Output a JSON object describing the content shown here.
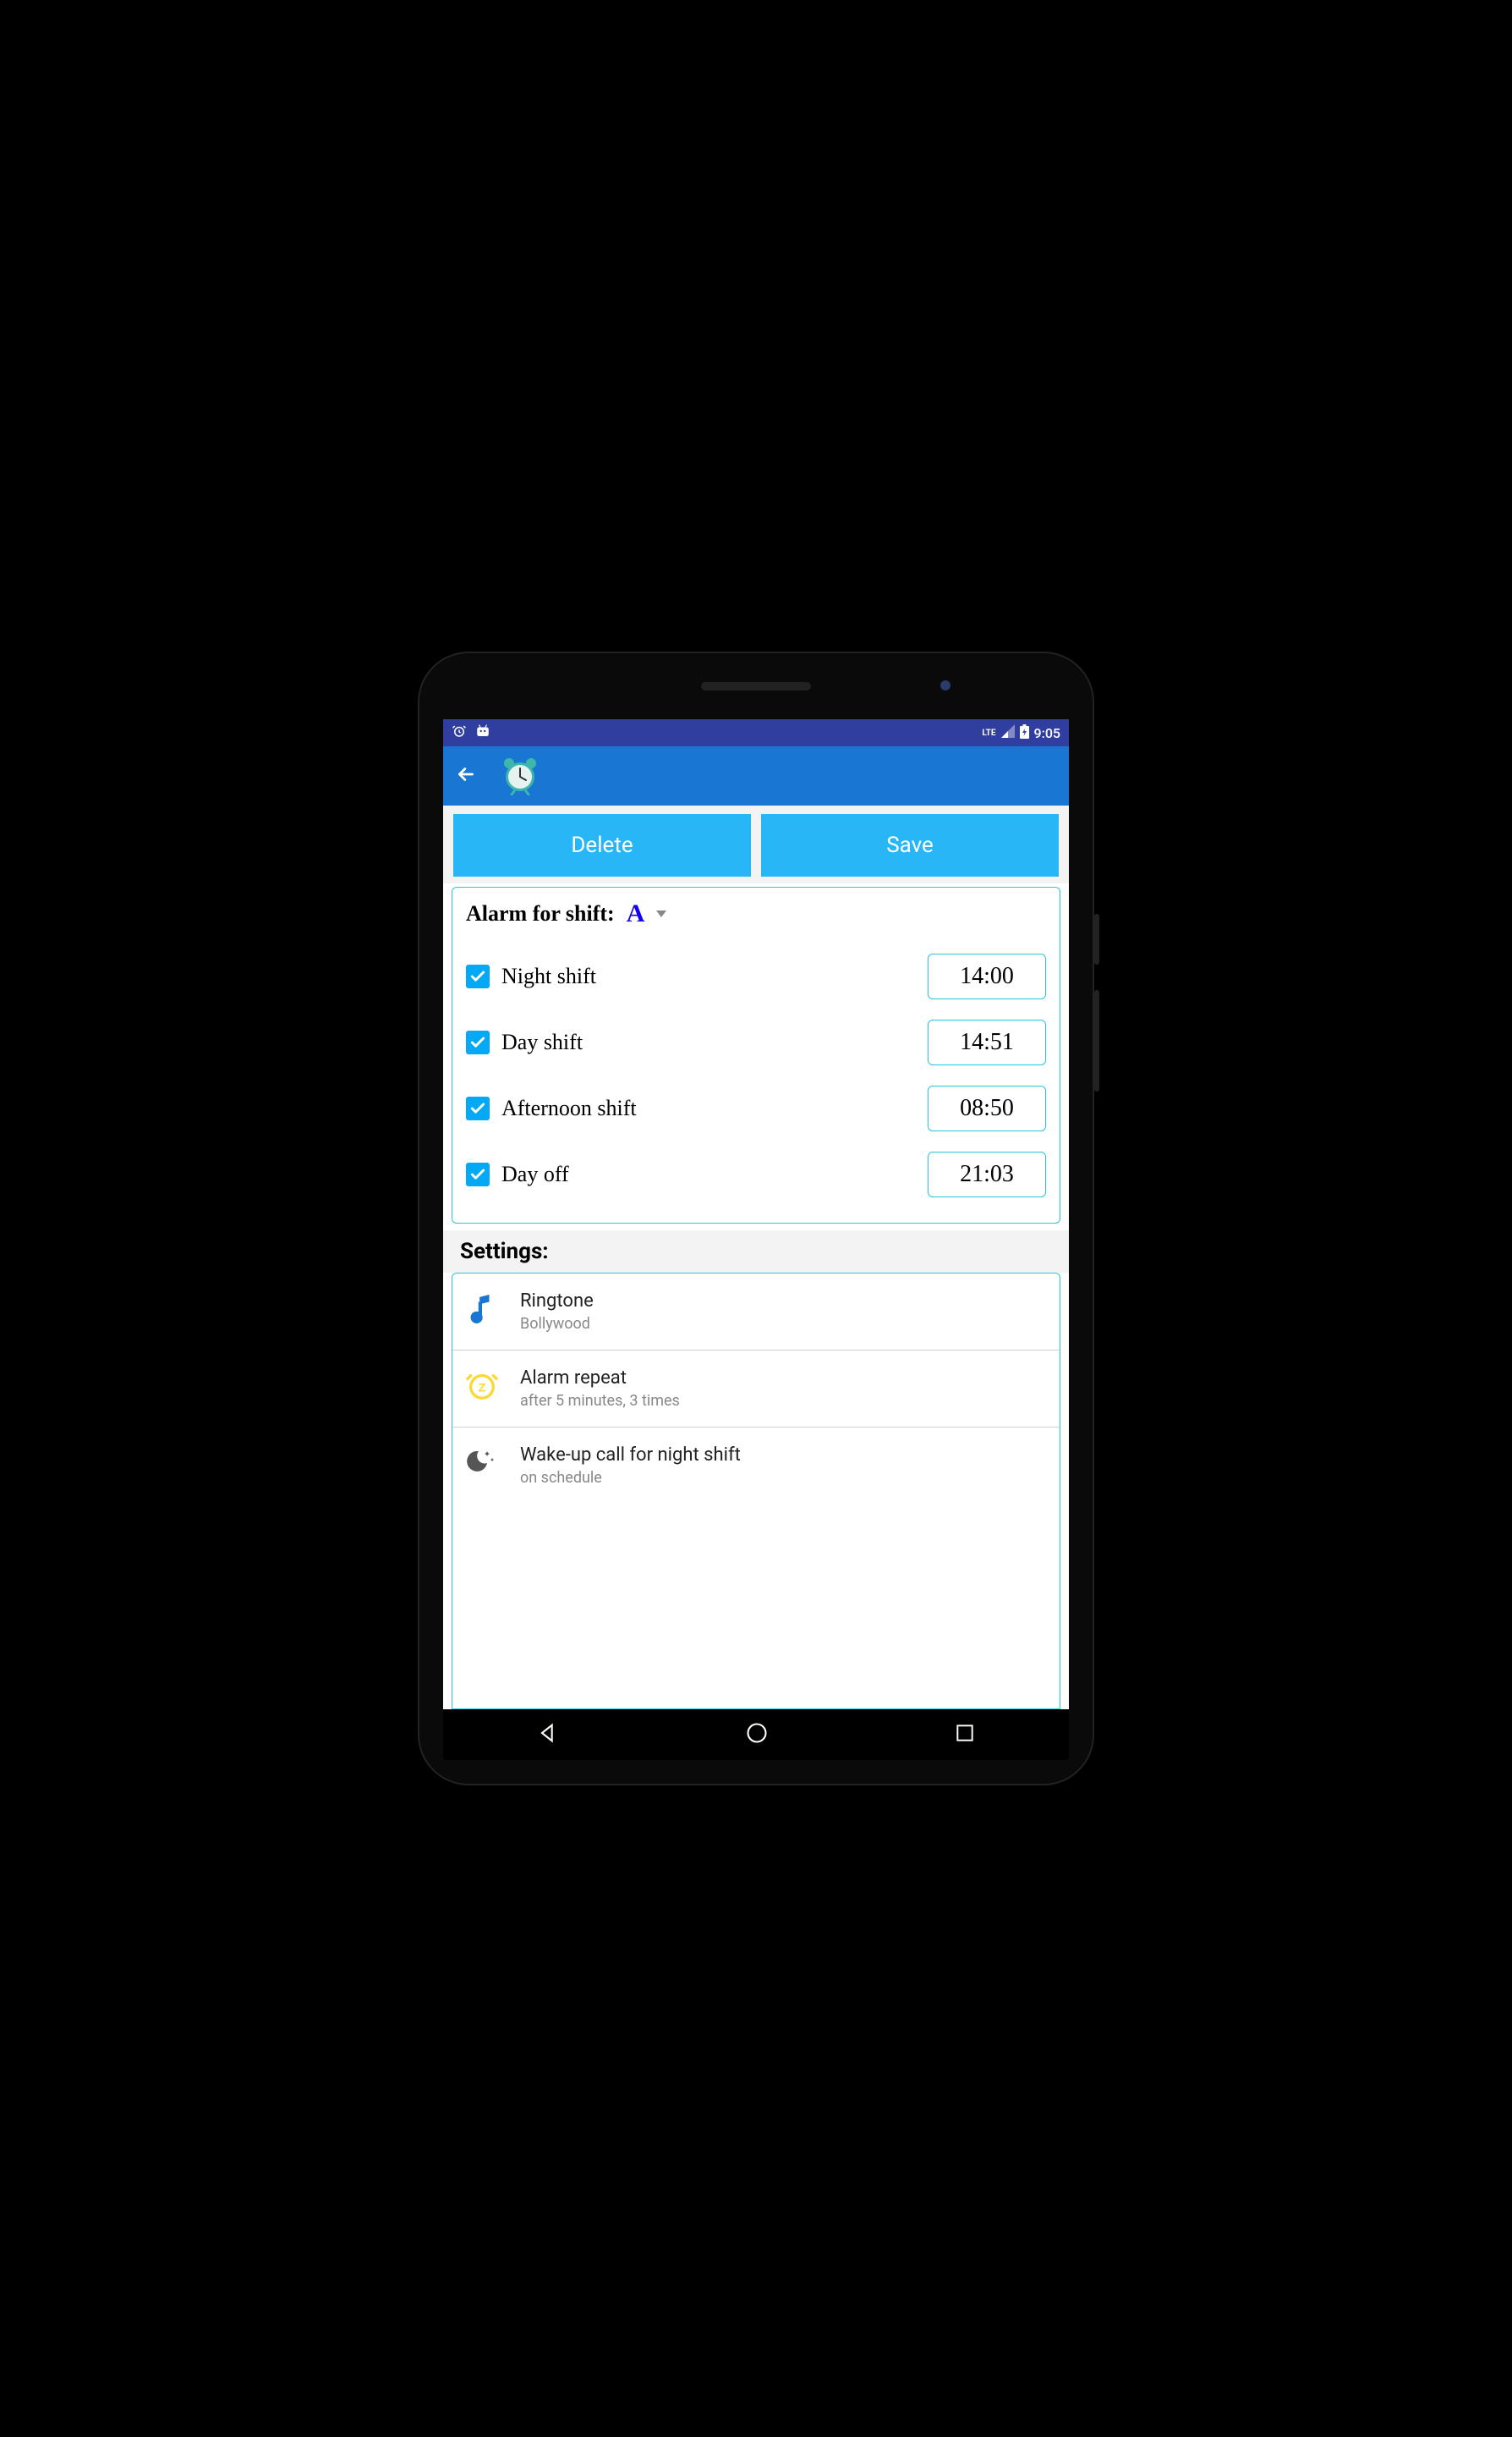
{
  "status": {
    "time": "9:05",
    "lte": "LTE"
  },
  "actions": {
    "delete": "Delete",
    "save": "Save"
  },
  "shift_header": {
    "label": "Alarm for shift:",
    "selected": "A"
  },
  "shifts": [
    {
      "label": "Night shift",
      "time": "14:00",
      "checked": true
    },
    {
      "label": "Day shift",
      "time": "14:51",
      "checked": true
    },
    {
      "label": "Afternoon shift",
      "time": "08:50",
      "checked": true
    },
    {
      "label": "Day off",
      "time": "21:03",
      "checked": true
    }
  ],
  "settings_header": "Settings:",
  "settings": [
    {
      "icon": "music-note",
      "title": "Ringtone",
      "sub": "Bollywood"
    },
    {
      "icon": "snooze",
      "title": "Alarm repeat",
      "sub": "after 5 minutes, 3 times"
    },
    {
      "icon": "moon-stars",
      "title": "Wake-up call for night shift",
      "sub": "on schedule"
    }
  ]
}
